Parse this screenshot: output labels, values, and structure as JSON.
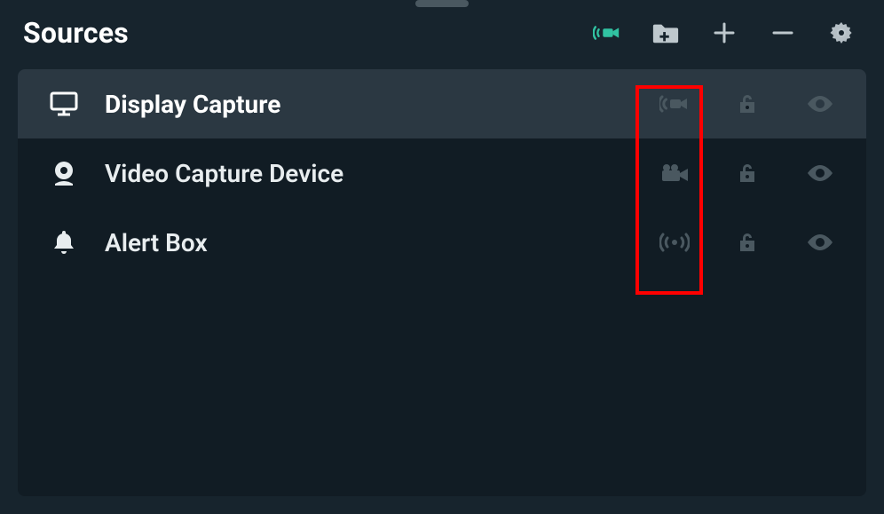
{
  "panel": {
    "title": "Sources"
  },
  "toolbar": {
    "start_stream_icon": "stream-camera-icon",
    "add_folder_icon": "folder-add-icon",
    "add_source_icon": "plus-icon",
    "remove_source_icon": "minus-icon",
    "settings_icon": "gear-icon"
  },
  "sources": [
    {
      "icon": "monitor-icon",
      "label": "Display Capture",
      "selected": true,
      "type_icon": "stream-camera-icon",
      "lock_icon": "lock-open-icon",
      "visibility_icon": "eye-icon"
    },
    {
      "icon": "webcam-icon",
      "label": "Video Capture Device",
      "selected": false,
      "type_icon": "video-camera-icon",
      "lock_icon": "lock-open-icon",
      "visibility_icon": "eye-icon"
    },
    {
      "icon": "bell-icon",
      "label": "Alert Box",
      "selected": false,
      "type_icon": "broadcast-icon",
      "lock_icon": "lock-open-icon",
      "visibility_icon": "eye-icon"
    }
  ],
  "annotation": {
    "highlights": "source type icon column"
  }
}
